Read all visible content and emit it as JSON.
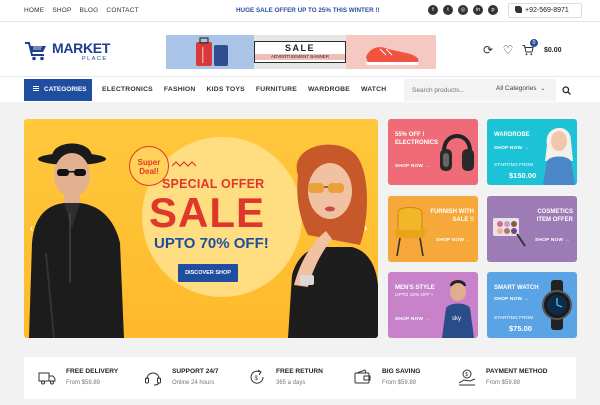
{
  "topbar": {
    "nav": [
      "HOME",
      "SHOP",
      "BLOG",
      "CONTACT"
    ],
    "promo": "HUGE SALE OFFER UP TO 25% THIS WINTER !!",
    "socials": [
      "facebook-icon",
      "twitter-icon",
      "instagram-icon",
      "linkedin-icon",
      "pinterest-icon"
    ],
    "phone": "+92-569-8971"
  },
  "header": {
    "logo_line1": "MARKET",
    "logo_line2": "PLACE",
    "banner_title": "SALE",
    "banner_sub": "ADVERTISEMENT BANNER",
    "cart_count": "0",
    "cart_total": "$0.00"
  },
  "catnav": {
    "categories_label": "CATEGORIES",
    "links": [
      "ELECTRONICS",
      "FASHION",
      "KIDS TOYS",
      "FURNITURE",
      "WARDROBE",
      "WATCH"
    ],
    "search_placeholder": "Search products...",
    "search_category": "All Categories"
  },
  "hero": {
    "badge_line1": "Super",
    "badge_line2": "Deal!",
    "headline": "SPECIAL OFFER",
    "sale": "SALE",
    "upto": "UPTO 70% OFF!",
    "cta": "DISCOVER SHOP"
  },
  "tiles": [
    {
      "title": "55% OFF ! ELECTRONICS",
      "shop": "SHOP NOW →",
      "color": "#ef6b78"
    },
    {
      "title": "WARDROBE",
      "shop": "SHOP NOW →",
      "start": "STARTING FROM",
      "price": "$150.00",
      "color": "#1cc3d6"
    },
    {
      "title": "FURNISH WITH SALE !!",
      "shop": "SHOP NOW →",
      "color": "#f6a93a"
    },
    {
      "title": "COSMETICS ITEM OFFER",
      "shop": "SHOP NOW →",
      "color": "#9d7bb5"
    },
    {
      "title": "MEN'S STYLE",
      "sub": "UPTO 15% OFF !",
      "shop": "SHOP NOW →",
      "color": "#c882c9"
    },
    {
      "title": "SMART WATCH",
      "shop": "SHOP NOW →",
      "start": "STARTING FROM",
      "price": "$75.00",
      "color": "#5aa4e6"
    }
  ],
  "features": [
    {
      "title": "FREE DELIVERY",
      "sub": "From $59.89",
      "icon": "truck-icon"
    },
    {
      "title": "SUPPORT 24/7",
      "sub": "Online 24 hours",
      "icon": "headset-icon"
    },
    {
      "title": "FREE RETURN",
      "sub": "365 a days",
      "icon": "return-icon"
    },
    {
      "title": "BIG SAVING",
      "sub": "From $59.89",
      "icon": "wallet-icon"
    },
    {
      "title": "PAYMENT METHOD",
      "sub": "From $59.89",
      "icon": "payment-icon"
    }
  ],
  "colors": {
    "brand": "#1f4ea1",
    "sale": "#e0372c",
    "hero_bg": "#ffbf33"
  }
}
